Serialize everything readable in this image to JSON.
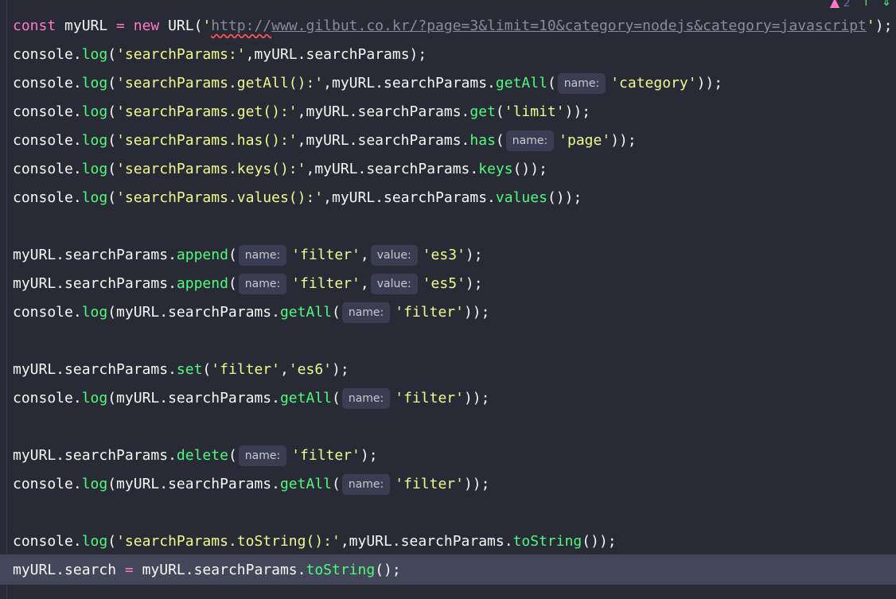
{
  "status": {
    "warning_count": "2",
    "warning_icon": "warning-icon",
    "up_icon": "arrow-up-icon",
    "down_icon": "arrow-down-icon"
  },
  "colors": {
    "background": "#282a36",
    "current_line": "#44475a",
    "keyword": "#ff79c6",
    "string": "#f1fa8c",
    "function": "#50fa7b",
    "text": "#f8f8f2",
    "hint_background": "#3b3e52"
  },
  "code": {
    "l1": {
      "kw_const": "const",
      "var": " myURL ",
      "op": "=",
      "kw_new": " new ",
      "cls": "URL(",
      "q_open": "'",
      "url_proto": "http://",
      "url_rest": "www.gilbut.co.kr/?page=3&limit=10&category=nodejs&category=javascript",
      "q_close": "'",
      "close": ");"
    },
    "l2": {
      "a": "console.",
      "fn": "log",
      "b": "(",
      "s": "'searchParams:'",
      "c": ",myURL.searchParams);"
    },
    "l3": {
      "a": "console.",
      "fn": "log",
      "b": "(",
      "s": "'searchParams.getAll():'",
      "c": ",myURL.searchParams.",
      "fn2": "getAll",
      "d": "(",
      "hint": "name:",
      "s2": "'category'",
      "e": "));"
    },
    "l4": {
      "a": "console.",
      "fn": "log",
      "b": "(",
      "s": "'searchParams.get():'",
      "c": ",myURL.searchParams.",
      "fn2": "get",
      "d": "(",
      "s2": "'limit'",
      "e": "));"
    },
    "l5": {
      "a": "console.",
      "fn": "log",
      "b": "(",
      "s": "'searchParams.has():'",
      "c": ",myURL.searchParams.",
      "fn2": "has",
      "d": "(",
      "hint": "name:",
      "s2": "'page'",
      "e": "));"
    },
    "l6": {
      "a": "console.",
      "fn": "log",
      "b": "(",
      "s": "'searchParams.keys():'",
      "c": ",myURL.searchParams.",
      "fn2": "keys",
      "e": "());"
    },
    "l7": {
      "a": "console.",
      "fn": "log",
      "b": "(",
      "s": "'searchParams.values():'",
      "c": ",myURL.searchParams.",
      "fn2": "values",
      "e": "());"
    },
    "l9": {
      "a": "myURL.searchParams.",
      "fn": "append",
      "b": "(",
      "hint1": "name:",
      "s1": "'filter'",
      "c": ",",
      "hint2": "value:",
      "s2": "'es3'",
      "e": ");"
    },
    "l10": {
      "a": "myURL.searchParams.",
      "fn": "append",
      "b": "(",
      "hint1": "name:",
      "s1": "'filter'",
      "c": ",",
      "hint2": "value:",
      "s2": "'es5'",
      "e": ");"
    },
    "l11": {
      "a": "console.",
      "fn": "log",
      "b": "(myURL.searchParams.",
      "fn2": "getAll",
      "d": "(",
      "hint": "name:",
      "s": "'filter'",
      "e": "));"
    },
    "l13": {
      "a": "myURL.searchParams.",
      "fn": "set",
      "b": "(",
      "s1": "'filter'",
      "c": ",",
      "s2": "'es6'",
      "e": ");"
    },
    "l14": {
      "a": "console.",
      "fn": "log",
      "b": "(myURL.searchParams.",
      "fn2": "getAll",
      "d": "(",
      "hint": "name:",
      "s": "'filter'",
      "e": "));"
    },
    "l16": {
      "a": "myURL.searchParams.",
      "fn": "delete",
      "b": "(",
      "hint": "name:",
      "s": "'filter'",
      "e": ");"
    },
    "l17": {
      "a": "console.",
      "fn": "log",
      "b": "(myURL.searchParams.",
      "fn2": "getAll",
      "d": "(",
      "hint": "name:",
      "s": "'filter'",
      "e": "));"
    },
    "l19": {
      "a": "console.",
      "fn": "log",
      "b": "(",
      "s": "'searchParams.toString():'",
      "c": ",myURL.searchParams.",
      "fn2": "toString",
      "e": "());"
    },
    "l20": {
      "a": "myURL.search ",
      "op": "=",
      "b": " myURL.searchParams.",
      "fn": "toString",
      "e": "();"
    }
  }
}
